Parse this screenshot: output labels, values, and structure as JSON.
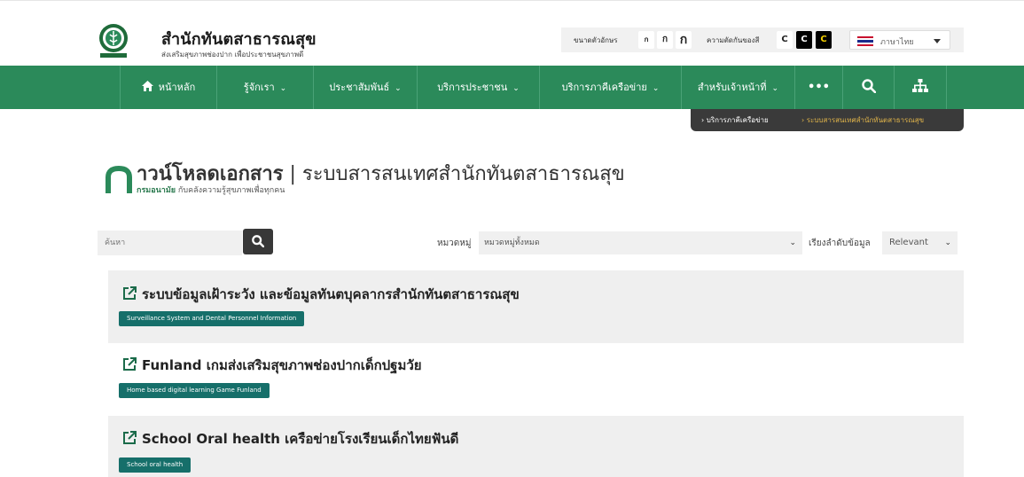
{
  "header": {
    "title": "สำนักทันตสาธารณสุข",
    "subtitle": "ส่งเสริมสุขภาพช่องปาก เพื่อประชาชนสุขภาพดี",
    "font_size_label": "ขนาดตัวอักษร",
    "font_sizes": [
      "ก",
      "ก",
      "ก"
    ],
    "contrast_label": "ความตัดกันของสี",
    "contrast_options": [
      "C",
      "C",
      "C"
    ],
    "language": "ภาษาไทย"
  },
  "nav": {
    "items": [
      {
        "label": "หน้าหลัก",
        "icon": "home-icon"
      },
      {
        "label": "รู้จักเรา"
      },
      {
        "label": "ประชาสัมพันธ์"
      },
      {
        "label": "บริการประชาชน"
      },
      {
        "label": "บริการภาคีเครือข่าย"
      },
      {
        "label": "สำหรับเจ้าหน้าที่"
      }
    ],
    "more": "•••"
  },
  "breadcrumb": {
    "items": [
      "บริการภาคีเครือข่าย",
      "ระบบสารสนเทศสำนักทันตสาธารณสุข"
    ]
  },
  "page": {
    "title_bold": "าวน์โหลดเอกสาร",
    "title_rest": " | ระบบสารสนเทศสำนักทันตสาธารณสุข",
    "sub_bold": "กรมอนามัย",
    "sub_rest": " กับคลังความรู้สุขภาพเพื่อทุกคน"
  },
  "filters": {
    "search_placeholder": "ค้นหา",
    "category_label": "หมวดหมู่",
    "category_value": "หมวดหมู่ทั้งหมด",
    "sort_label": "เรียงลำดับข้อมูล",
    "sort_value": "Relevant"
  },
  "documents": [
    {
      "title": "ระบบข้อมูลเฝ้าระวัง และข้อมูลทันตบุคลากรสำนักทันตสาธารณสุข",
      "tag": "Surveillance System and Dental Personnel Information"
    },
    {
      "title": "Funland เกมส่งเสริมสุขภาพช่องปากเด็กปฐมวัย",
      "tag": "Home based digital learning Game Funland"
    },
    {
      "title": "School Oral health เครือข่ายโรงเรียนเด็กไทยฟันดี",
      "tag": "School oral health"
    }
  ],
  "colors": {
    "nav_green": "#2b8a5a",
    "tag_teal": "#166f6a",
    "breadcrumb_active": "#e0b44a"
  }
}
